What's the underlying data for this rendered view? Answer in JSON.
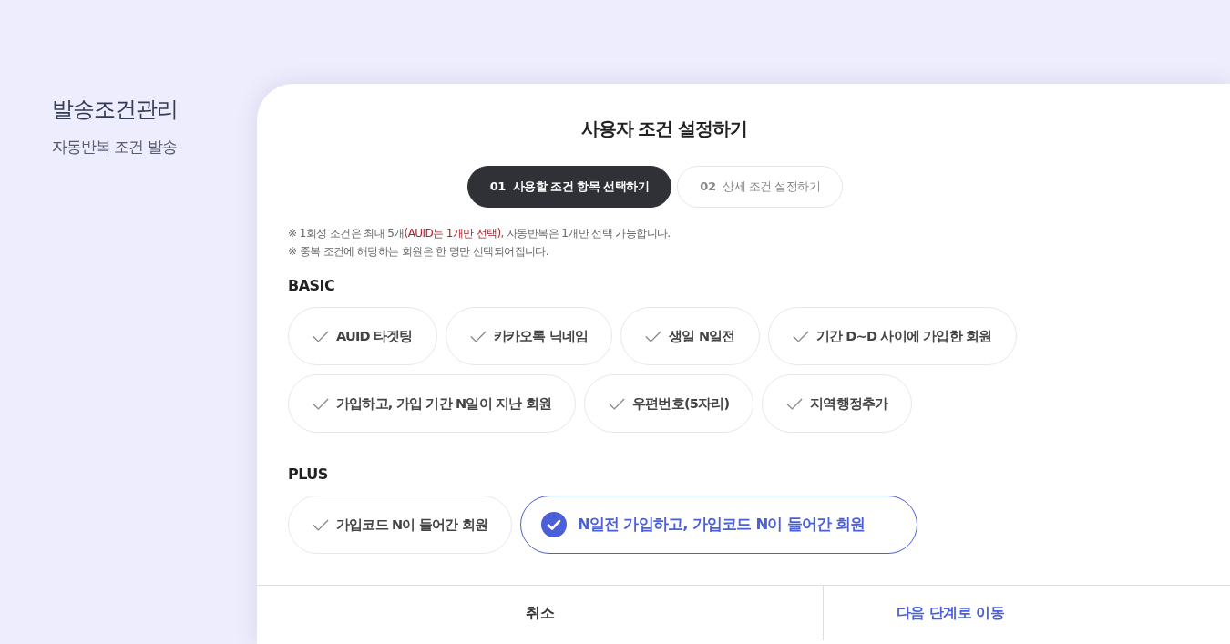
{
  "sidebar": {
    "title": "발송조건관리",
    "subtitle": "자동반복 조건 발송"
  },
  "dialog": {
    "title": "사용자 조건 설정하기",
    "steps": [
      {
        "number": "01",
        "label": "사용할 조건 항목 선택하기",
        "selected": true
      },
      {
        "number": "02",
        "label": "상세 조건 설정하기",
        "selected": false
      }
    ],
    "notes": [
      [
        {
          "text": "※ 1회성 조건은 최대 5개",
          "highlight": false
        },
        {
          "text": "(AUID는 1개만 선택)",
          "highlight": true
        },
        {
          "text": ", 자동반복은 1개만 선택 가능합니다.",
          "highlight": false
        }
      ],
      [
        {
          "text": "※ 중복 조건에 해당하는 회원은 한 명만 선택되어집니다.",
          "highlight": false
        }
      ]
    ],
    "groups": [
      {
        "title": "BASIC",
        "options": [
          {
            "label": "AUID 타겟팅",
            "checked": false
          },
          {
            "label": "카카오톡 닉네임",
            "checked": false
          },
          {
            "label": "생일 N일전",
            "checked": false
          },
          {
            "label": "기간 D~D 사이에 가입한 회원",
            "checked": false
          },
          {
            "label": "가입하고, 가입 기간 N일이 지난 회원",
            "checked": false
          },
          {
            "label": "우편번호(5자리)",
            "checked": false
          },
          {
            "label": "지역행정추가",
            "checked": false
          }
        ]
      },
      {
        "title": "PLUS",
        "options": [
          {
            "label": "가입코드 N이 들어간 회원",
            "checked": false
          },
          {
            "label": "N일전 가입하고, 가입코드 N이 들어간 회원",
            "checked": true
          }
        ]
      }
    ],
    "buttons": [
      {
        "label": "취소",
        "kind": "cancel"
      },
      {
        "label": "다음 단계로 이동",
        "kind": "next"
      }
    ]
  }
}
